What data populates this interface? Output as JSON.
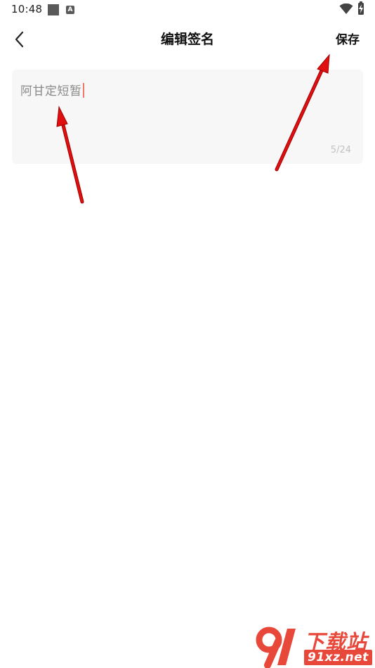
{
  "status_bar": {
    "time": "10:48",
    "notification_icon_letter": "A",
    "icons": [
      "square-icon",
      "a-badge-icon",
      "wifi-icon",
      "battery-icon"
    ]
  },
  "header": {
    "title": "编辑签名",
    "save_label": "保存",
    "back_icon": "chevron-left-icon"
  },
  "editor": {
    "value": "阿甘定短暂",
    "counter": "5/24",
    "caret_color": "#f2776d"
  },
  "annotation": {
    "arrow_color": "#e01010"
  },
  "watermark": {
    "title": "下载站",
    "site": "91xz.net",
    "color": "#e8483a"
  }
}
